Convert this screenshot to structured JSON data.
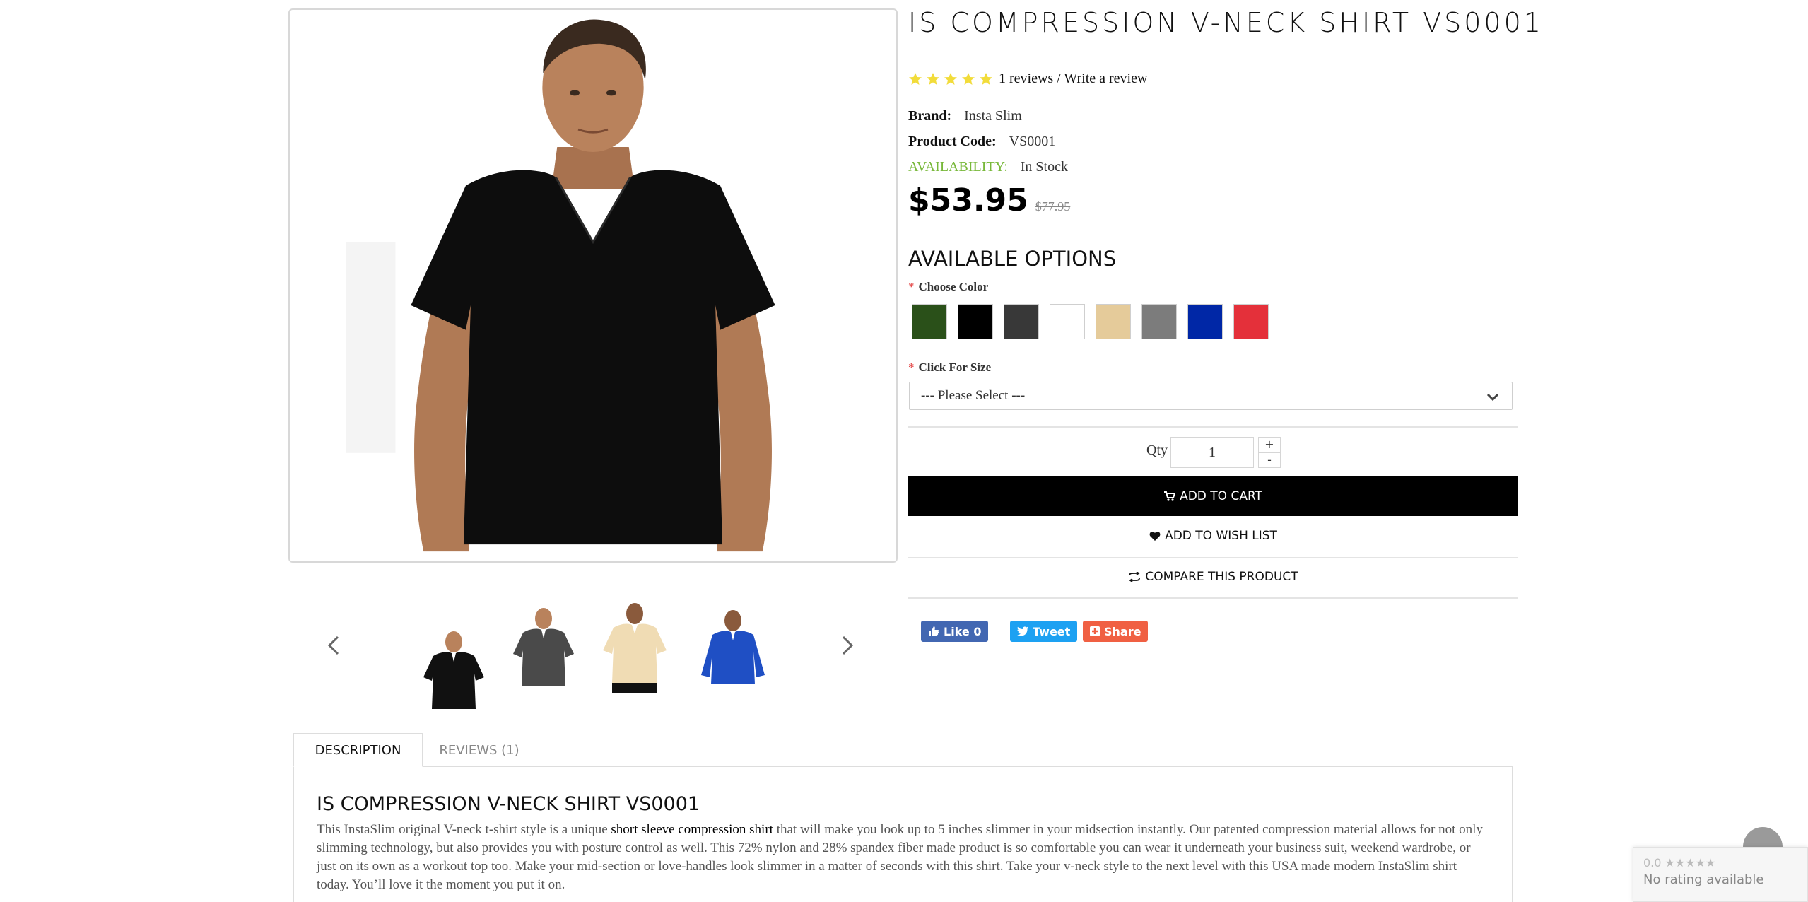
{
  "product": {
    "title": "IS COMPRESSION V-NECK SHIRT VS0001",
    "rating_stars": 5,
    "reviews_link": "1 reviews",
    "rating_separator": " / ",
    "write_review_link": "Write a review",
    "brand_label": "Brand:",
    "brand_value": "Insta Slim",
    "code_label": "Product Code:",
    "code_value": "VS0001",
    "availability_label": "AVAILABILITY:",
    "availability_value": "In Stock",
    "price": "$53.95",
    "old_price": "$77.95"
  },
  "options": {
    "title": "AVAILABLE OPTIONS",
    "required_mark": "*",
    "color_label": "Choose Color",
    "colors": [
      "#2a5019",
      "#000000",
      "#383838",
      "#ffffff",
      "#e5cb9a",
      "#7c7c7c",
      "#0027a6",
      "#e4303a"
    ],
    "size_label": "Click For Size",
    "size_selected": "--- Please Select ---"
  },
  "cart": {
    "qty_label": "Qty",
    "qty_value": "1",
    "qty_plus": "+",
    "qty_minus": "-",
    "add_to_cart": "ADD TO CART",
    "add_to_wishlist": "ADD TO WISH LIST",
    "compare": "COMPARE THIS PRODUCT"
  },
  "social": {
    "like": "Like 0",
    "tweet": "Tweet",
    "share": "Share"
  },
  "tabs": {
    "description": "DESCRIPTION",
    "reviews": "REVIEWS (1)"
  },
  "description": {
    "title": "IS COMPRESSION V-NECK SHIRT VS0001",
    "text_before": "This InstaSlim original V-neck t-shirt style is a unique ",
    "link": "short sleeve compression shirt",
    "text_after": " that will make you look up to 5 inches slimmer in your midsection instantly. Our patented compression material allows for not only slimming technology, but also provides you with posture control as well. This 72% nylon and 28% spandex fiber made product is so comfortable you can wear it underneath your business suit, weekend wardrobe, or just on its own as a workout top too. Make your mid-section or love-handles look slimmer in a matter of seconds with this shirt. Take your v-neck style to the next level with this USA made modern InstaSlim shirt today. You’ll love it the moment you put it on."
  },
  "thumbnails": {
    "shirt_colors": [
      "#111111",
      "#4a4a4a",
      "#f0dcb4",
      "#1f4fc4"
    ]
  },
  "rating_widget": {
    "score": "0.0 ★★★★★",
    "text": "No rating available"
  },
  "colors": {
    "accent_green": "#78b83a",
    "facebook": "#4267b2",
    "twitter": "#1da1f2",
    "share": "#f06043",
    "cart_button": "#000000"
  }
}
